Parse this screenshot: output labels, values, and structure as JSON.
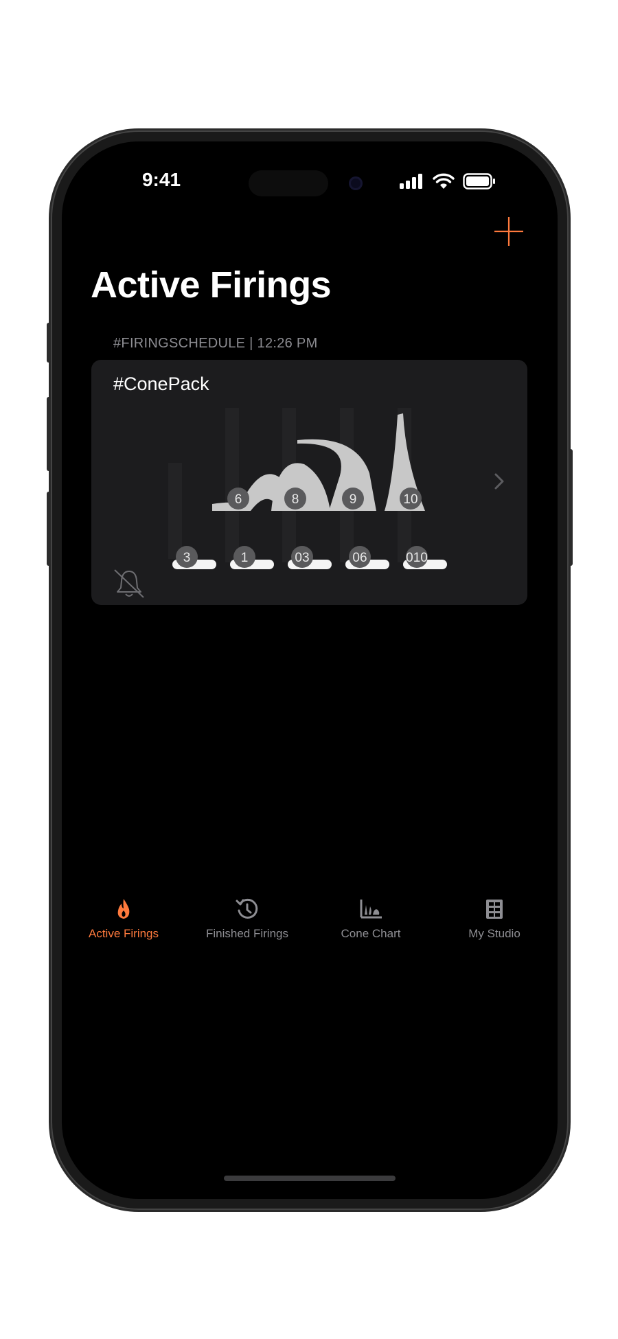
{
  "status_bar": {
    "time": "9:41"
  },
  "nav": {
    "title": "Active Firings",
    "add_icon": "plus-icon"
  },
  "section": {
    "header": "#FIRINGSCHEDULE | 12:26 PM"
  },
  "card": {
    "title": "#ConePack",
    "bent_cones": [
      "6",
      "8",
      "9",
      "10"
    ],
    "flat_cones": [
      "3",
      "1",
      "03",
      "06",
      "010"
    ],
    "mute_icon": "bell-slash-icon",
    "chevron_icon": "chevron-right-icon"
  },
  "tabs": [
    {
      "label": "Active Firings",
      "icon": "flame-icon",
      "active": true
    },
    {
      "label": "Finished Firings",
      "icon": "history-icon",
      "active": false
    },
    {
      "label": "Cone Chart",
      "icon": "cone-chart-icon",
      "active": false
    },
    {
      "label": "My Studio",
      "icon": "kiln-icon",
      "active": false
    }
  ],
  "colors": {
    "accent": "#ff7a3d",
    "background": "#000000",
    "card": "#1c1c1e",
    "secondary_text": "#8d8d92"
  }
}
